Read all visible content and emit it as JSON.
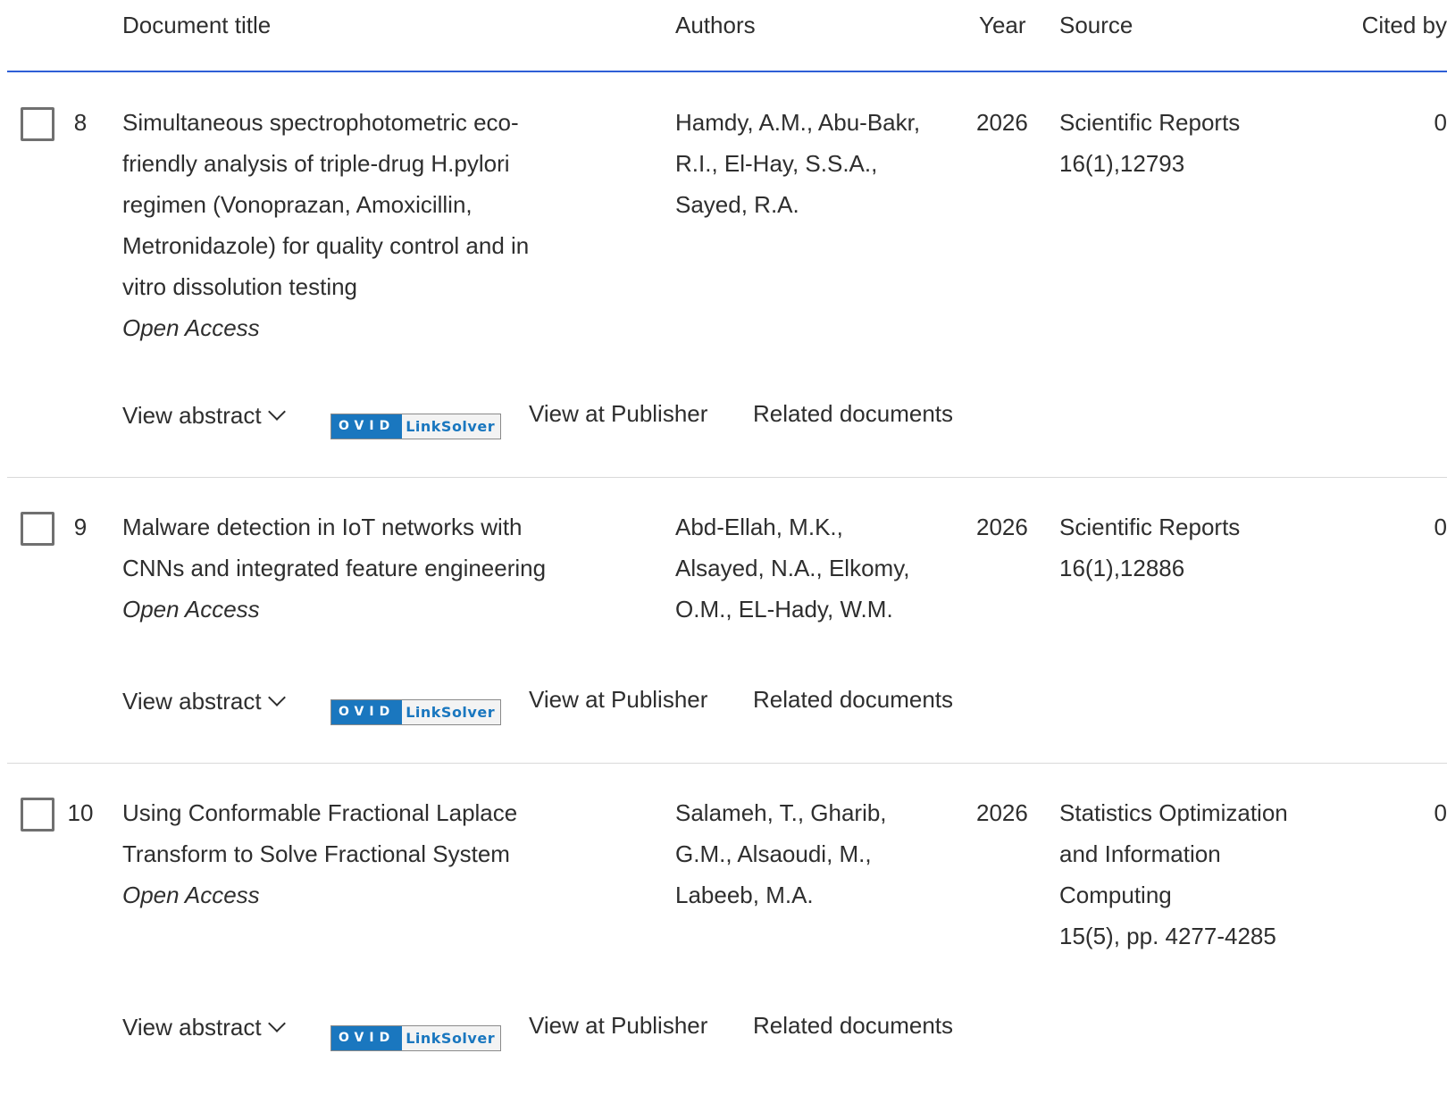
{
  "header": {
    "title": "Document title",
    "authors": "Authors",
    "year": "Year",
    "source": "Source",
    "cited_by": "Cited by"
  },
  "actions": {
    "view_abstract": "View abstract",
    "ovid": "OVID",
    "linksolver": "LinkSolver",
    "view_at_publisher": "View at Publisher",
    "related_documents": "Related documents"
  },
  "rows": [
    {
      "num": "8",
      "title_lines": [
        "Simultaneous spectrophotometric eco-",
        "friendly analysis of triple-drug H.pylori",
        "regimen (Vonoprazan, Amoxicillin,",
        "Metronidazole) for quality control and in",
        "vitro dissolution testing"
      ],
      "access": "Open Access",
      "author_lines": [
        "Hamdy, A.M., Abu-Bakr,",
        "R.I., El-Hay, S.S.A.,",
        "Sayed, R.A."
      ],
      "year": "2026",
      "source_lines": [
        "Scientific Reports"
      ],
      "volume": "16(1),12793",
      "cited": "0"
    },
    {
      "num": "9",
      "title_lines": [
        "Malware detection in IoT networks with",
        "CNNs and integrated feature engineering"
      ],
      "access": "Open Access",
      "author_lines": [
        "Abd-Ellah, M.K.,",
        "Alsayed, N.A., Elkomy,",
        "O.M., EL-Hady, W.M."
      ],
      "year": "2026",
      "source_lines": [
        "Scientific Reports"
      ],
      "volume": "16(1),12886",
      "cited": "0"
    },
    {
      "num": "10",
      "title_lines": [
        "Using Conformable Fractional Laplace",
        "Transform to Solve Fractional System"
      ],
      "access": "Open Access",
      "author_lines": [
        "Salameh, T., Gharib,",
        "G.M., Alsaoudi, M.,",
        "Labeeb, M.A."
      ],
      "year": "2026",
      "source_lines": [
        "Statistics Optimization",
        "and Information",
        "Computing"
      ],
      "volume": "15(5), pp. 4277-4285",
      "cited": "0"
    }
  ]
}
